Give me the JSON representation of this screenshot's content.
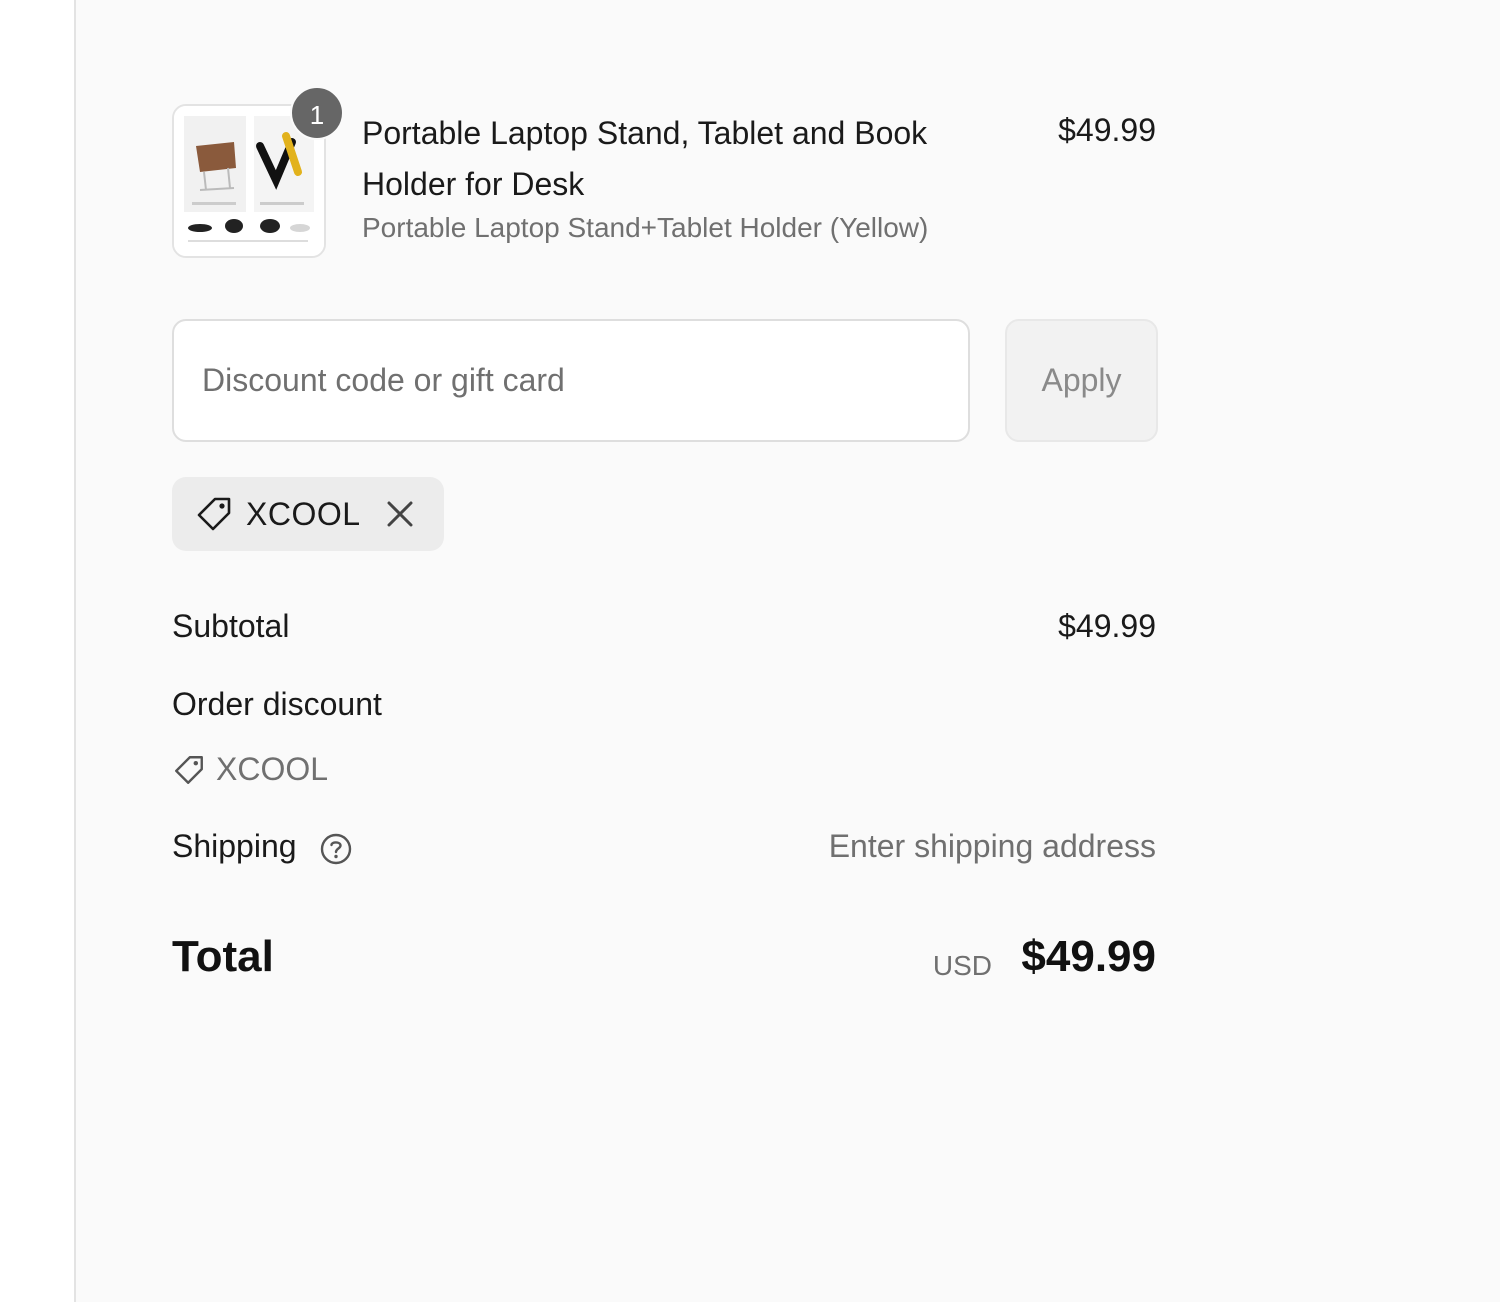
{
  "product": {
    "quantity": "1",
    "title": "Portable Laptop Stand, Tablet and Book Holder for Desk",
    "variant": "Portable Laptop Stand+Tablet Holder (Yellow)",
    "price": "$49.99",
    "image_icon": "product-image"
  },
  "discount": {
    "placeholder": "Discount code or gift card",
    "apply_label": "Apply",
    "applied_code": "XCOOL"
  },
  "summary": {
    "subtotal_label": "Subtotal",
    "subtotal_value": "$49.99",
    "order_discount_label": "Order discount",
    "order_discount_code": "XCOOL",
    "shipping_label": "Shipping",
    "shipping_value": "Enter shipping address",
    "total_label": "Total",
    "total_currency": "USD",
    "total_value": "$49.99"
  },
  "colors": {
    "pane_background": "#fafafa",
    "badge": "#666666",
    "muted_text": "#707070",
    "tag_background": "#ececec"
  }
}
